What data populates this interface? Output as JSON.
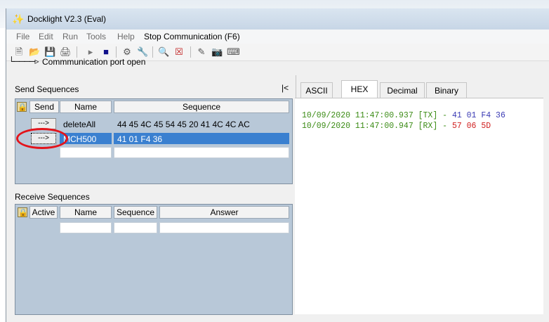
{
  "window": {
    "title": "Docklight V2.3 (Eval)",
    "app_icon": "docklight-logo-icon"
  },
  "menu": {
    "items": [
      "File",
      "Edit",
      "Run",
      "Tools",
      "Help"
    ],
    "stop": "Stop Communication  (F6)"
  },
  "status": {
    "port_text": "Commmunication port open"
  },
  "send": {
    "title": "Send Sequences",
    "collapse_label": "|<",
    "headers": {
      "send": "Send",
      "name": "Name",
      "sequence": "Sequence"
    },
    "rows": [
      {
        "send": "--->",
        "name": "deleteAll",
        "sequence": "44 45 4C 45 54 45 20 41 4C 4C AC"
      },
      {
        "send": "--->",
        "name": "MCH500",
        "sequence": "41 01 F4 36"
      }
    ]
  },
  "receive": {
    "title": "Receive Sequences",
    "headers": {
      "active": "Active",
      "name": "Name",
      "sequence": "Sequence",
      "answer": "Answer"
    }
  },
  "tabs": [
    "ASCII",
    "HEX",
    "Decimal",
    "Binary"
  ],
  "active_tab": "HEX",
  "log": [
    {
      "prefix": "10/09/2020 11:47:00.937 [TX] - ",
      "data": "41 01 F4 36",
      "data_color": "#3a3ab4"
    },
    {
      "prefix": "10/09/2020 11:47:00.947 [RX] - ",
      "data": "57 06 5D",
      "data_color": "#d02020"
    }
  ],
  "colors": {
    "selection": "#3a80d0",
    "table_bg": "#b8c8d8",
    "log_prefix": "#3c8c16",
    "annotation": "#e3141b"
  }
}
